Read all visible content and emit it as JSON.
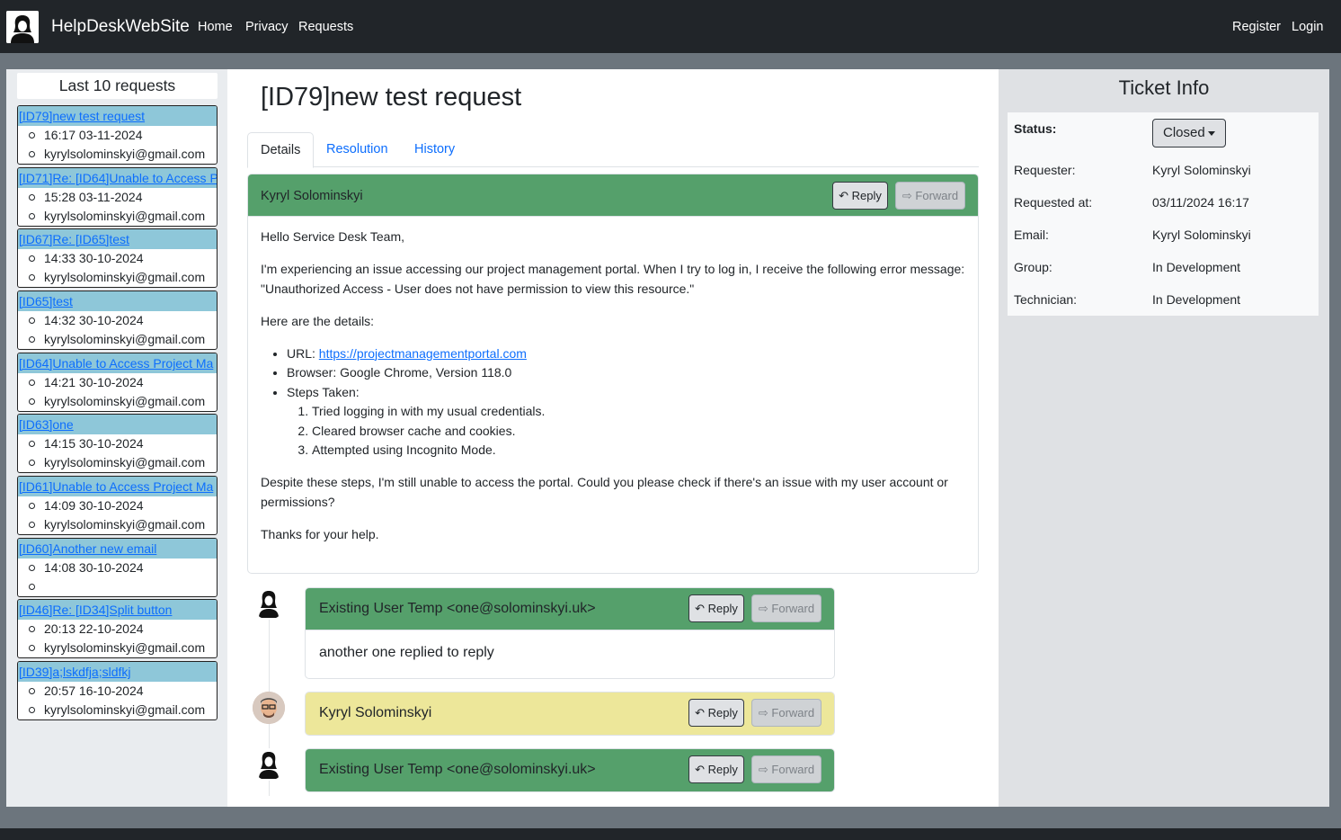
{
  "navbar": {
    "brand": "HelpDeskWebSite",
    "links": [
      "Home",
      "Privacy",
      "Requests"
    ],
    "register": "Register",
    "login": "Login"
  },
  "last_requests": {
    "title": "Last 10 requests",
    "items": [
      {
        "title": "[ID79]new test request",
        "time": "16:17 03-11-2024",
        "email": "kyrylsolominskyi@gmail.com"
      },
      {
        "title": "[ID71]Re: [ID64]Unable to Access P",
        "time": "15:28 03-11-2024",
        "email": "kyrylsolominskyi@gmail.com"
      },
      {
        "title": "[ID67]Re: [ID65]test",
        "time": "14:33 30-10-2024",
        "email": "kyrylsolominskyi@gmail.com"
      },
      {
        "title": "[ID65]test",
        "time": "14:32 30-10-2024",
        "email": "kyrylsolominskyi@gmail.com"
      },
      {
        "title": "[ID64]Unable to Access Project Ma",
        "time": "14:21 30-10-2024",
        "email": "kyrylsolominskyi@gmail.com"
      },
      {
        "title": "[ID63]one",
        "time": "14:15 30-10-2024",
        "email": "kyrylsolominskyi@gmail.com"
      },
      {
        "title": "[ID61]Unable to Access Project Ma",
        "time": "14:09 30-10-2024",
        "email": "kyrylsolominskyi@gmail.com"
      },
      {
        "title": "[ID60]Another new email",
        "time": "14:08 30-10-2024",
        "email": ""
      },
      {
        "title": "[ID46]Re: [ID34]Split button",
        "time": "20:13 22-10-2024",
        "email": "kyrylsolominskyi@gmail.com"
      },
      {
        "title": "[ID39]a;lskdfja;sldfkj",
        "time": "20:57 16-10-2024",
        "email": "kyrylsolominskyi@gmail.com"
      }
    ]
  },
  "ticket": {
    "title": "[ID79]new test request",
    "tabs": [
      "Details",
      "Resolution",
      "History"
    ],
    "reply_label": "Reply",
    "forward_label": "Forward",
    "main_message": {
      "sender": "Kyryl Solominskyi",
      "greeting": "Hello Service Desk Team,",
      "p1": "I'm experiencing an issue accessing our project management portal. When I try to log in, I receive the following error message: \"Unauthorized Access - User does not have permission to view this resource.\"",
      "p2": "Here are the details:",
      "url_label": "URL: ",
      "url": "https://projectmanagementportal.com",
      "browser": "Browser: Google Chrome, Version 118.0",
      "steps_label": "Steps Taken:",
      "steps": [
        "Tried logging in with my usual credentials.",
        "Cleared browser cache and cookies.",
        "Attempted using Incognito Mode."
      ],
      "p3": "Despite these steps, I'm still unable to access the portal. Could you please check if there's an issue with my user account or permissions?",
      "closing": "Thanks for your help."
    },
    "replies": [
      {
        "sender": "Existing User Temp <one@solominskyi.uk>",
        "body": "another one replied to reply"
      },
      {
        "sender": "Kyryl Solominskyi"
      },
      {
        "sender": "Existing User Temp <one@solominskyi.uk>"
      }
    ]
  },
  "ticket_info": {
    "title": "Ticket Info",
    "status_label": "Status:",
    "status_value": "Closed",
    "requester_label": "Requester:",
    "requester_value": "Kyryl Solominskyi",
    "requested_at_label": "Requested at:",
    "requested_at_value": "03/11/2024 16:17",
    "email_label": "Email:",
    "email_value": "Kyryl Solominskyi",
    "group_label": "Group:",
    "group_value": "In Development",
    "technician_label": "Technician:",
    "technician_value": "In Development"
  },
  "colors": {
    "navbar": "#212529",
    "card_header_green": "#55a06b",
    "card_header_yellow": "#ede79a",
    "request_header": "#8ec7d9",
    "link": "#0d6efd"
  }
}
